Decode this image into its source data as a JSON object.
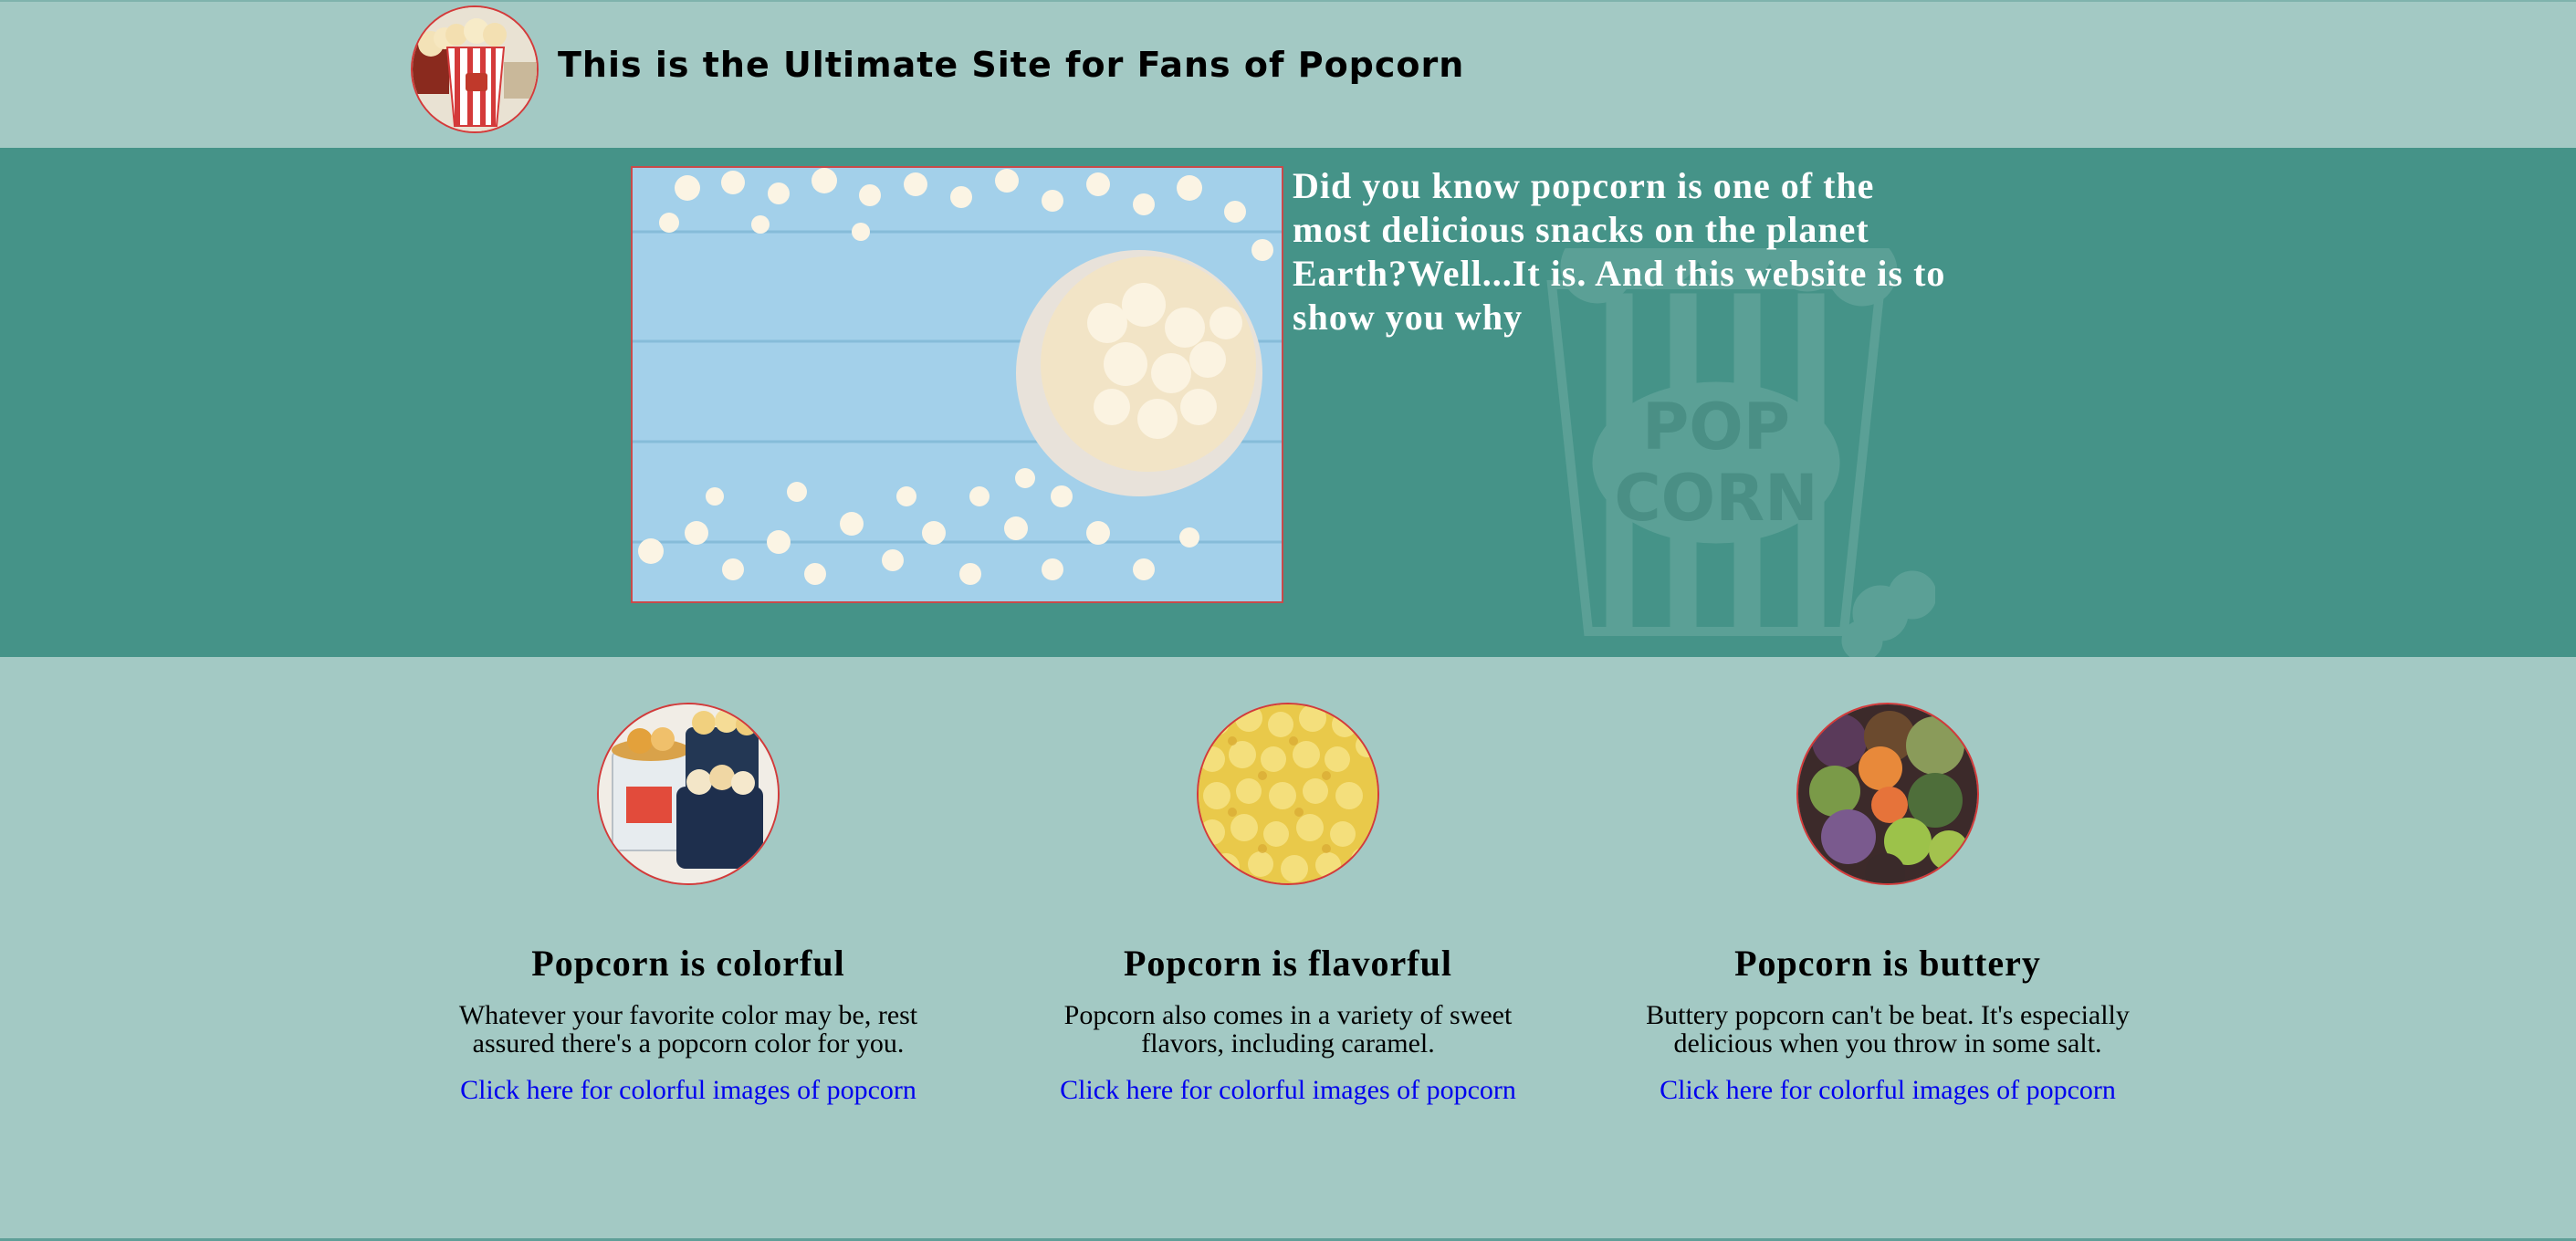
{
  "header": {
    "title": "This is the Ultimate Site for Fans of Popcorn",
    "logo_icon": "popcorn-box-icon"
  },
  "hero": {
    "text": "Did you know popcorn is one of the most delicious snacks on the planet Earth?Well...It is. And this website is to show you why",
    "watermark_text_top": "POP",
    "watermark_text_bottom": "CORN"
  },
  "features": [
    {
      "title": "Popcorn is colorful",
      "description": "Whatever your favorite color may be, rest assured there's a popcorn color for you.",
      "link": "Click here for colorful images of popcorn"
    },
    {
      "title": "Popcorn is flavorful",
      "description": "Popcorn also comes in a variety of sweet flavors, including caramel.",
      "link": "Click here for colorful images of popcorn"
    },
    {
      "title": "Popcorn is buttery",
      "description": "Buttery popcorn can't be beat. It's especially delicious when you throw in some salt.",
      "link": "Click here for colorful images of popcorn"
    }
  ],
  "colors": {
    "page_bg": "#a3c9c4",
    "hero_bg": "#459388",
    "accent_border": "#d43a3a",
    "link": "#0000ee"
  }
}
